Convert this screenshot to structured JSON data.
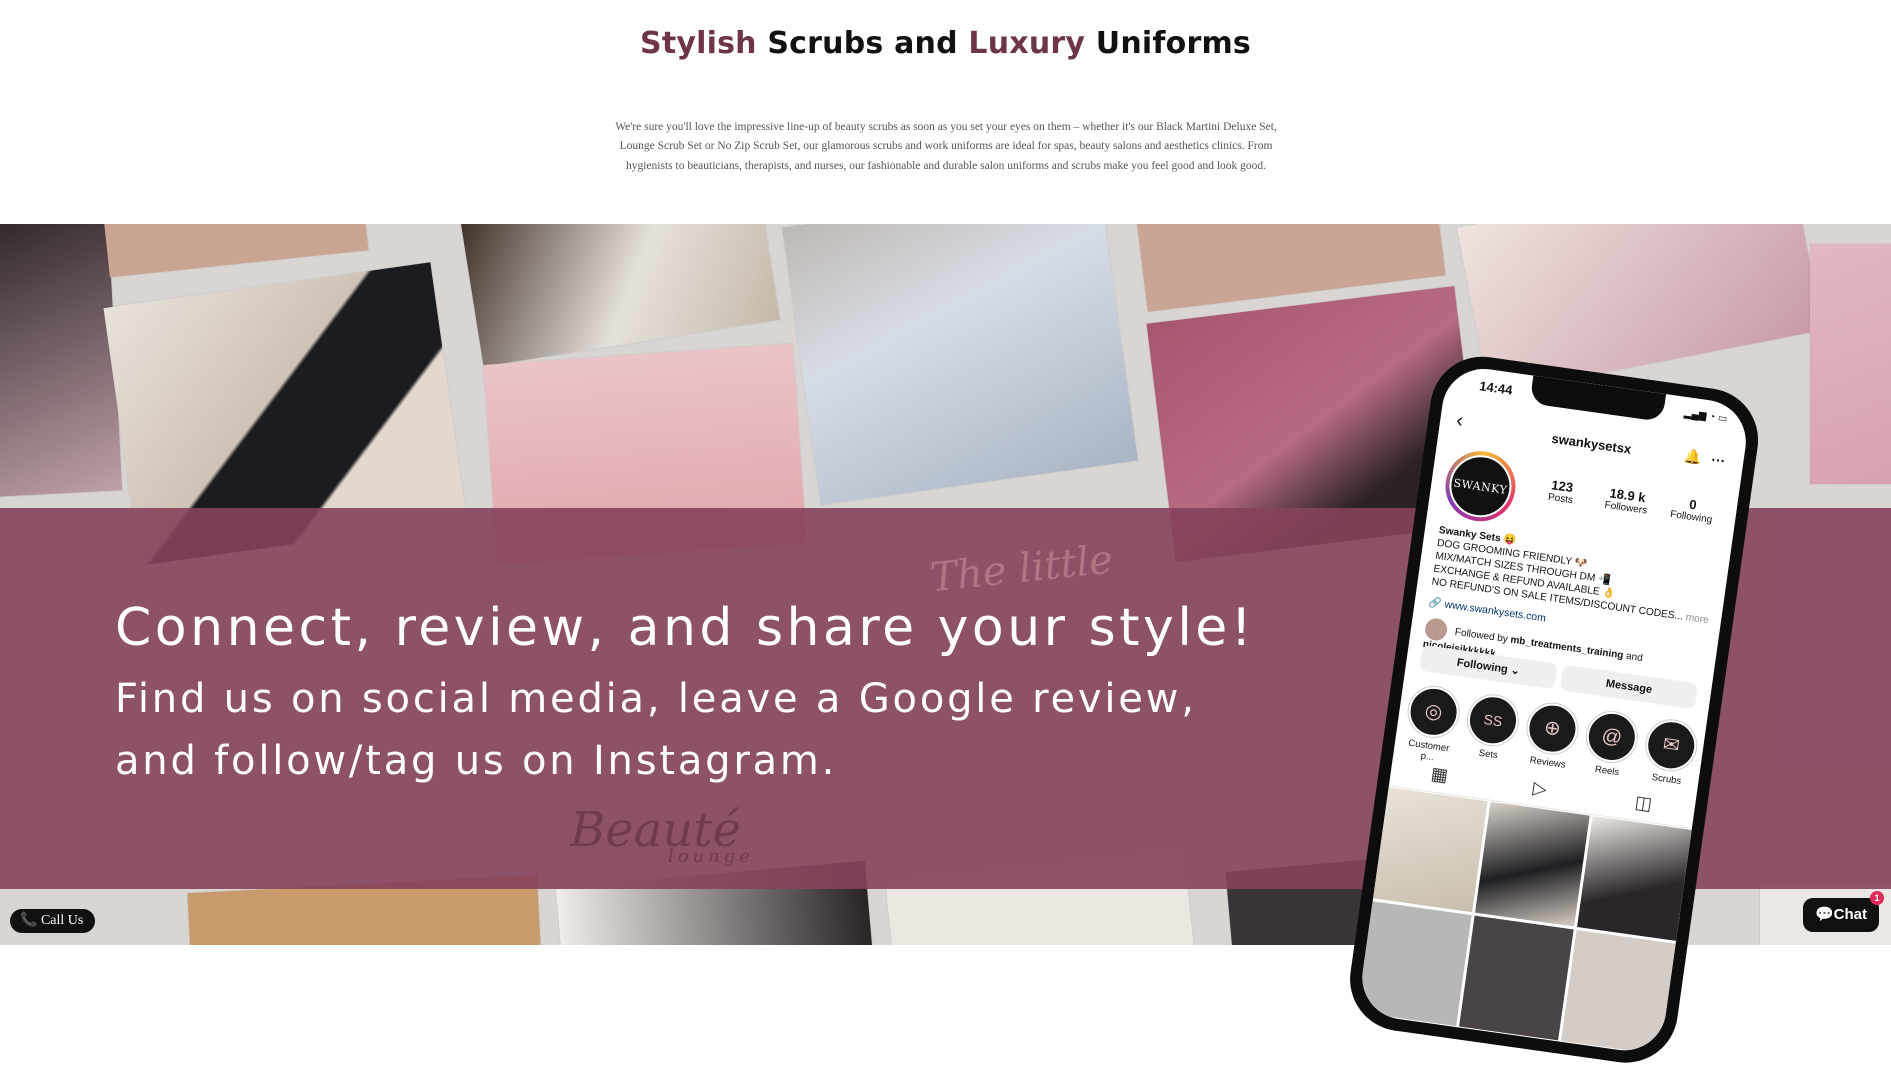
{
  "heading": {
    "word1": "Stylish",
    "word2": " Scrubs and ",
    "word3": "Luxury",
    "word4": " Uniforms",
    "accent_color": "#6e3448"
  },
  "intro": {
    "text": "We're sure you'll love the impressive line-up of beauty scrubs as soon as you set your eyes on them – whether it's our Black Martini Deluxe Set, Lounge Scrub Set or No Zip Scrub Set, our glamorous scrubs and work uniforms are ideal for spas, beauty salons and aesthetics clinics. From hygienists to beauticians, therapists, and nurses, our fashionable and durable salon uniforms and scrubs make you feel good and look good."
  },
  "banner": {
    "overlay_color": "#85425c",
    "line1": "Connect, review, and share your style!",
    "line2": "Find us on social media, leave a Google review,",
    "line3": "and follow/tag us on Instagram.",
    "script1": "The little",
    "script2": "Beauté",
    "script3": "lounge"
  },
  "phone": {
    "time": "14:44",
    "username": "swankysetsx",
    "avatar_text": "SWANKY",
    "stats": [
      {
        "value": "123",
        "label": "Posts"
      },
      {
        "value": "18.9 k",
        "label": "Followers"
      },
      {
        "value": "0",
        "label": "Following"
      }
    ],
    "bio_name": "Swanky Sets 😝",
    "bio_lines": [
      "DOG GROOMING FRIENDLY 🐶",
      "MIX/MATCH SIZES THROUGH DM 📲",
      "EXCHANGE & REFUND AVAILABLE 👌",
      "NO REFUND'S ON SALE ITEMS/DISCOUNT CODES..."
    ],
    "bio_more": "more",
    "link": "www.swankysets.com",
    "followed_prefix": "Followed by ",
    "followed_names": "mb_treatments_training",
    "followed_and": " and ",
    "followed_name2": "nicoleisikkkkkk",
    "following_button": "Following ⌄",
    "message_button": "Message",
    "highlights": [
      {
        "label": "Customer p...",
        "icon": "camera-icon"
      },
      {
        "label": "Sets",
        "icon": "ss-logo-icon"
      },
      {
        "label": "Reviews",
        "icon": "globe-icon"
      },
      {
        "label": "Reels",
        "icon": "at-icon"
      },
      {
        "label": "Scrubs",
        "icon": "envelope-icon"
      }
    ]
  },
  "call_button": {
    "label": "Call Us"
  },
  "chat_button": {
    "label": "Chat",
    "badge": "1"
  }
}
